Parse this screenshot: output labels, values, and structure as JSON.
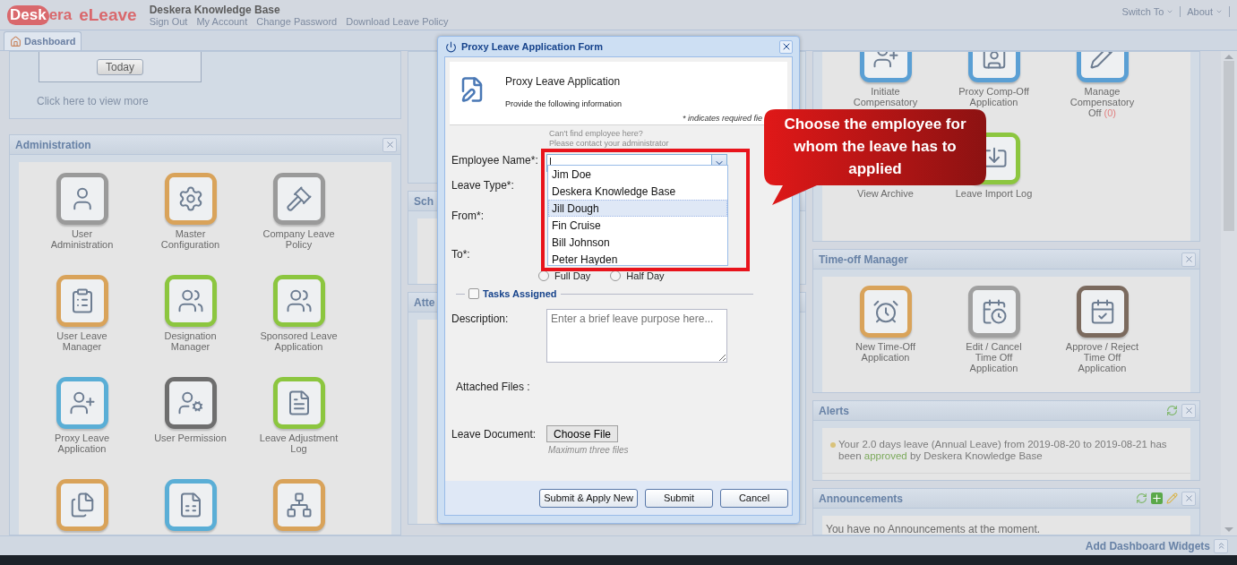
{
  "header": {
    "logo_mark": "Desk",
    "logo_rest": "era",
    "product": "eLeave",
    "company": "Deskera Knowledge Base",
    "links": [
      "Sign Out",
      "My Account",
      "Change Password",
      "Download Leave Policy"
    ],
    "menus": [
      "Switch To",
      "About"
    ]
  },
  "tabs": [
    {
      "label": "Dashboard",
      "selected": true
    }
  ],
  "calendar_panel": {
    "today_button": "Today",
    "link": "Click here to view more"
  },
  "administration": {
    "title": "Administration",
    "items": [
      {
        "label": "User Administration",
        "color": "#9a9a9a"
      },
      {
        "label": "Master Configuration",
        "color": "#d9a35a"
      },
      {
        "label": "Company Leave Policy",
        "color": "#9a9a9a"
      },
      {
        "label": "User Leave Manager",
        "color": "#d9a35a"
      },
      {
        "label": "Designation Manager",
        "color": "#8cc63f"
      },
      {
        "label": "Sponsored Leave Application",
        "color": "#8cc63f"
      },
      {
        "label": "Proxy Leave Application",
        "color": "#5aaed6"
      },
      {
        "label": "User Permission",
        "color": "#6e6e6e"
      },
      {
        "label": "Leave Adjustment Log",
        "color": "#8cc63f"
      },
      {
        "color": "#d9a35a"
      },
      {
        "color": "#5aaed6"
      },
      {
        "color": "#d9a35a"
      }
    ]
  },
  "middle_panels": [
    {
      "title": "Sch"
    },
    {
      "title": "Atte"
    }
  ],
  "compensatory_panel": {
    "items": [
      {
        "label": "Initiate Compensatory",
        "color": "#5a9fd4"
      },
      {
        "label": "Proxy Comp-Off Application",
        "color": "#5a9fd4"
      },
      {
        "label": "Manage Compensatory Off",
        "count": "(0)",
        "color": "#5a9fd4"
      },
      {
        "label": "View Archive"
      },
      {
        "label": "Leave Import Log",
        "color": "#8cc63f"
      }
    ]
  },
  "time_off_manager": {
    "title": "Time-off Manager",
    "items": [
      {
        "label": "New Time-Off Application",
        "color": "#d9a35a"
      },
      {
        "label": "Edit / Cancel Time Off Application",
        "color": "#a0a0a0"
      },
      {
        "label": "Approve / Reject Time Off Application",
        "color": "#7b6a5e"
      }
    ]
  },
  "alerts": {
    "title": "Alerts",
    "items": [
      {
        "before": "Your 2.0 days leave (Annual Leave) from 2019-08-20 to 2019-08-21 has been ",
        "status": "approved",
        "after": " by Deskera Knowledge Base"
      }
    ]
  },
  "announcements": {
    "title": "Announcements",
    "message": "You have no Announcements at the moment."
  },
  "footer": {
    "add_widgets": "Add Dashboard Widgets"
  },
  "dialog": {
    "title": "Proxy Leave Application Form",
    "heading": "Proxy Leave Application",
    "subheading": "Provide the following information",
    "required_note": "* indicates required fie",
    "hint": [
      "Can't find employee here?",
      "Please contact your administrator"
    ],
    "labels": {
      "employee": "Employee Name*:",
      "leave_type": "Leave Type*:",
      "from": "From*:",
      "to": "To*:",
      "description": "Description:",
      "attached": "Attached Files :",
      "document": "Leave Document:"
    },
    "employees": [
      {
        "name": "Jim Doe",
        "selected": false
      },
      {
        "name": "Deskera Knowledge Base",
        "selected": false
      },
      {
        "name": "Jill Dough",
        "selected": true
      },
      {
        "name": "Fin Cruise",
        "selected": false
      },
      {
        "name": "Bill Johnson",
        "selected": false
      },
      {
        "name": "Peter Hayden",
        "selected": false
      }
    ],
    "day_options": [
      {
        "label": "Full Day",
        "checked": false
      },
      {
        "label": "Half Day",
        "checked": false
      }
    ],
    "tasks": {
      "label": "Tasks Assigned",
      "checked": false
    },
    "description_placeholder": "Enter a brief leave purpose here...",
    "choose_file": "Choose File",
    "file_note": "Maximum three files",
    "buttons": [
      "Submit & Apply New",
      "Submit",
      "Cancel"
    ]
  },
  "callout": {
    "text": "Choose the employee for whom the leave has to applied"
  }
}
